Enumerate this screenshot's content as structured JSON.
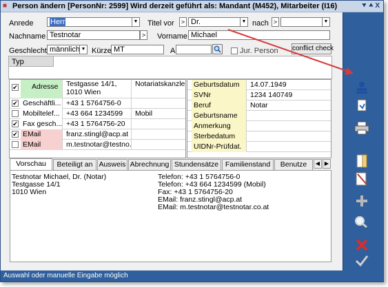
{
  "window": {
    "title": "Person ändern  [PersonNr: 2599] Wird derzeit geführt als: Mandant (M452), Mitarbeiter (I16)",
    "title_buttons": "⯆⯅X"
  },
  "form": {
    "anrede_label": "Anrede",
    "anrede_value": "Herr",
    "titel_vor_label": "Titel vor",
    "titel_vor_sep": ">",
    "titel_vor_value": "Dr.",
    "nach_label": "nach",
    "nach_sep": ">",
    "nach_value": "",
    "nachname_label": "Nachname",
    "nachname_value": "Testnotar",
    "nachname_sep": ">",
    "vorname_label": "Vorname",
    "vorname_value": "Michael",
    "geschlecht_label": "Geschlecht",
    "geschlecht_value": "männlich",
    "kuerzel_label": "Kürzel",
    "kuerzel_value": "MT",
    "altkrz_label": "Alt.Krz",
    "altkrz_value": "",
    "jur_person_label": "Jur. Person",
    "conflict_label": "conflict check"
  },
  "typ": {
    "header": "Typ"
  },
  "contacts": [
    {
      "checked": true,
      "type": "Adresse",
      "value": "Testgasse 14/1,",
      "value2": "1010 Wien",
      "extra": "Notariatskanzlei",
      "bg": "#c6efc6"
    },
    {
      "checked": true,
      "type": "Geschäftli...",
      "value": "+43 1 5764756-0",
      "extra": "",
      "bg": "#ffffff"
    },
    {
      "checked": false,
      "type": "Mobiltelef...",
      "value": "+43 664 1234599",
      "extra": "Mobil",
      "bg": "#ffffff"
    },
    {
      "checked": true,
      "type": "Fax gesch...",
      "value": "+43 1 5764756-20",
      "extra": "",
      "bg": "#ffffff"
    },
    {
      "checked": true,
      "type": "EMail",
      "value": "franz.stingl@acp.at",
      "extra": "",
      "bg": "#f7d0d0"
    },
    {
      "checked": false,
      "type": "EMail",
      "value": "m.testnotar@testno...",
      "extra": "",
      "bg": "#f7d0d0"
    }
  ],
  "details": [
    {
      "label": "Geburtsdatum",
      "value": "14.07.1949"
    },
    {
      "label": "SVNr",
      "value": "1234 140749"
    },
    {
      "label": "Beruf",
      "value": "Notar"
    },
    {
      "label": "Geburtsname",
      "value": ""
    },
    {
      "label": "Anmerkung",
      "value": ""
    },
    {
      "label": "Sterbedatum",
      "value": ""
    },
    {
      "label": "UIDNr-Prüfdat.",
      "value": ""
    }
  ],
  "tabs": [
    "Vorschau",
    "Beteiligt an",
    "Ausweis",
    "Abrechnung",
    "Stundensätze",
    "Familienstand",
    "Benutze"
  ],
  "preview": {
    "left": [
      "Testnotar Michael, Dr. (Notar)",
      "Testgasse 14/1",
      "1010 Wien"
    ],
    "right": [
      "Telefon: +43 1 5764756-0",
      "Telefon: +43 664 1234599 (Mobil)",
      "Fax: +43 1 5764756-20",
      "EMail: franz.stingl@acp.at",
      "EMail: m.testnotar@testnotar.co.at"
    ]
  },
  "toolbar": [
    "person-stamp-icon",
    "document-link-icon",
    "printer-icon",
    "notes-icon",
    "edit-document-icon",
    "add-icon",
    "search-icon",
    "delete-icon",
    "confirm-icon"
  ],
  "status": {
    "text": "Auswahl oder manuelle Eingabe möglich"
  },
  "colors": {
    "accent": "#2f5f9c",
    "selected_field": "#3a6ec2",
    "arrow": "#d63a3a",
    "detail_label_bg": "#fbf6c8"
  }
}
